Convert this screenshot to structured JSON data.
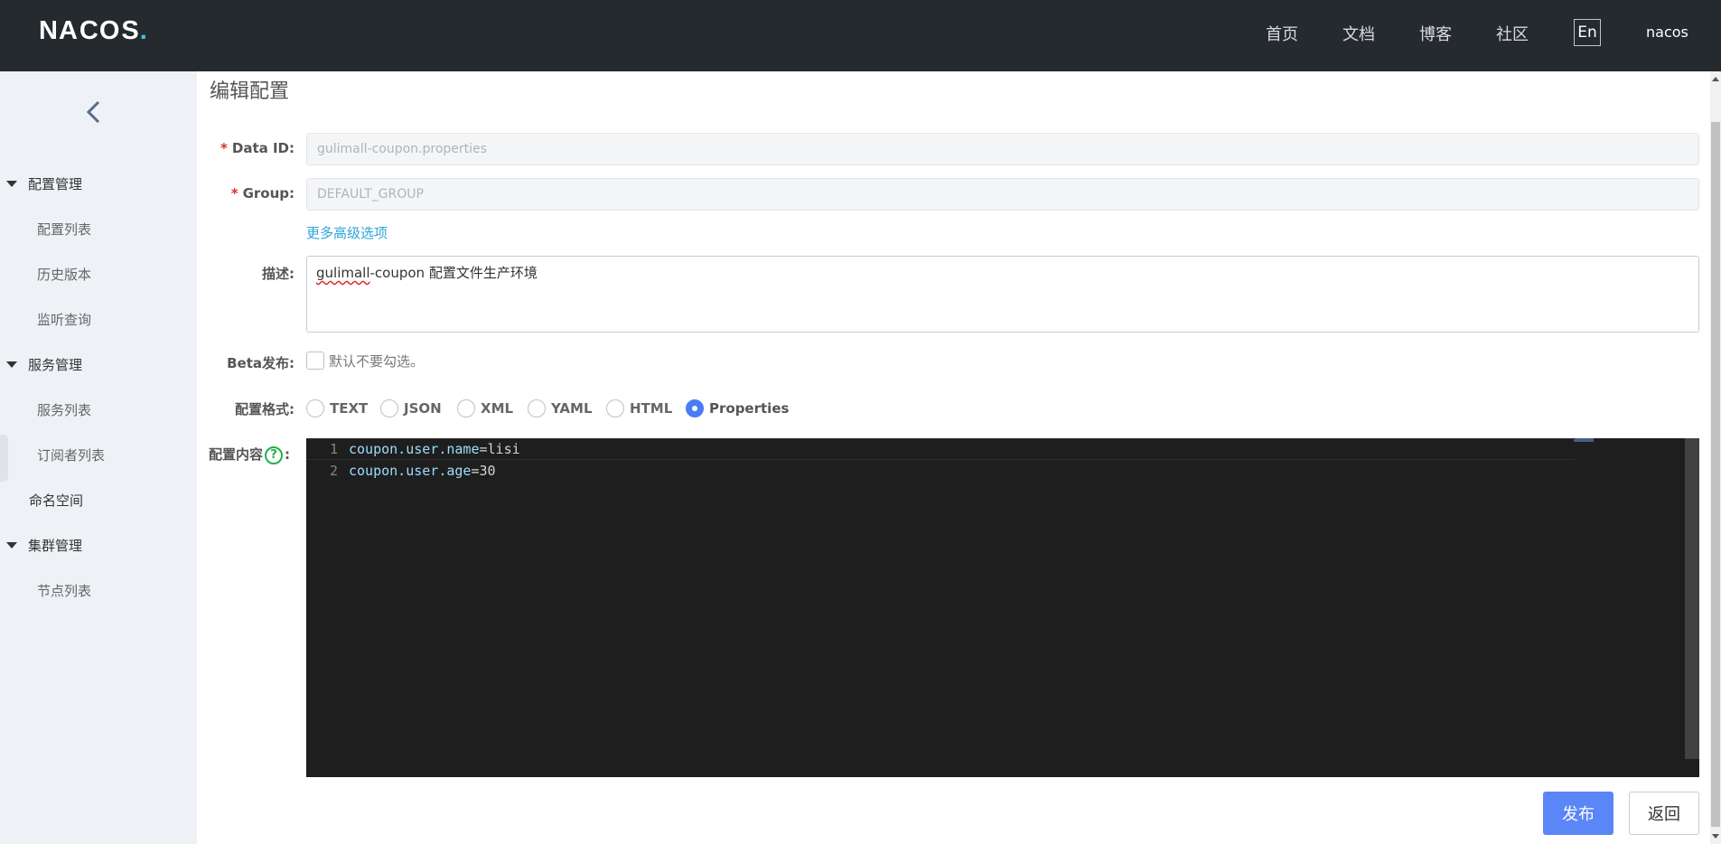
{
  "header": {
    "logo": {
      "part1": "NA",
      "part2": "CO",
      "part3": "S",
      "dot": "."
    },
    "nav": [
      "首页",
      "文档",
      "博客",
      "社区"
    ],
    "lang": "En",
    "user": "nacos"
  },
  "sidebar": {
    "groups": [
      {
        "label": "配置管理",
        "items": [
          "配置列表",
          "历史版本",
          "监听查询"
        ]
      },
      {
        "label": "服务管理",
        "items": [
          "服务列表",
          "订阅者列表"
        ]
      },
      {
        "label": "集群管理",
        "items": [
          "节点列表"
        ]
      }
    ],
    "plain_item": "命名空间"
  },
  "form": {
    "title": "编辑配置",
    "data_id": {
      "label": "Data ID:",
      "value": "gulimall-coupon.properties"
    },
    "group": {
      "label": "Group:",
      "value": "DEFAULT_GROUP"
    },
    "advanced_link": "更多高级选项",
    "description": {
      "label": "描述:",
      "value_marked": "gulimall",
      "value_rest": "-coupon 配置文件生产环境"
    },
    "beta": {
      "label": "Beta发布:",
      "hint": "默认不要勾选。",
      "checked": false
    },
    "format": {
      "label": "配置格式:",
      "options": [
        "TEXT",
        "JSON",
        "XML",
        "YAML",
        "HTML",
        "Properties"
      ],
      "selected": "Properties"
    },
    "content": {
      "label": "配置内容",
      "label_suffix": ":",
      "help_icon": "?",
      "lines": [
        {
          "num": "1",
          "key": "coupon.user.name",
          "eq": "=",
          "val": "lisi"
        },
        {
          "num": "2",
          "key": "coupon.user.age",
          "eq": "=",
          "val": "30"
        }
      ]
    },
    "buttons": {
      "publish": "发布",
      "back": "返回"
    }
  },
  "colors": {
    "topbar": "#252a2f",
    "sidebar": "#eef1f5",
    "primary": "#5a86f7",
    "link": "#2aa6d9",
    "required": "#e02b2b",
    "help": "#22b04b",
    "editor_bg": "#1e1e1e"
  }
}
